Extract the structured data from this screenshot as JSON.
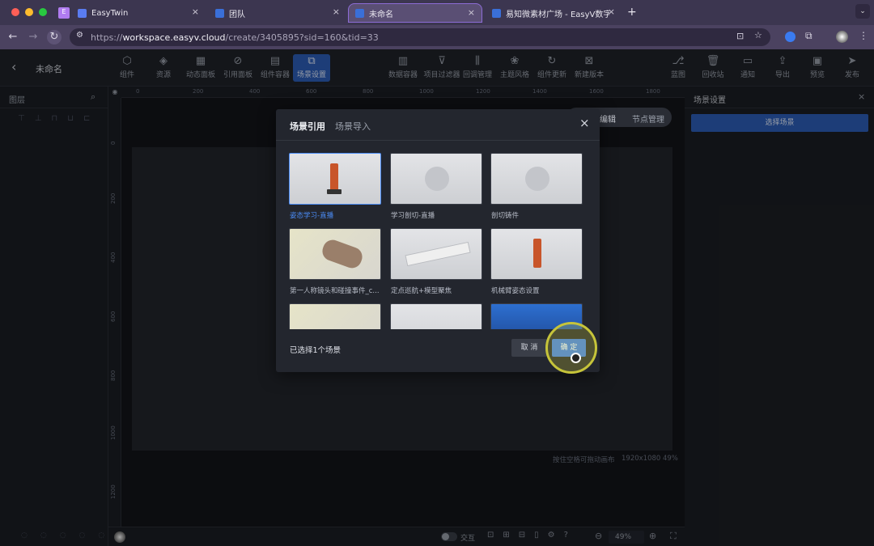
{
  "browser": {
    "tabs": [
      {
        "label": "",
        "icon": "E"
      },
      {
        "label": "EasyTwin"
      },
      {
        "label": "团队"
      },
      {
        "label": "未命名"
      },
      {
        "label": "易知微素材广场 - EasyV数字孪"
      }
    ],
    "url_prefix": "https://",
    "url_host": "workspace.easyv.cloud",
    "url_path": "/create/3405895?sid=160&tid=33"
  },
  "header": {
    "back_label": "‹",
    "title": "未命名",
    "left_tools": [
      {
        "label": "组件",
        "icon": "component-icon"
      },
      {
        "label": "资源",
        "icon": "layers-icon"
      },
      {
        "label": "动态面板",
        "icon": "panel-icon"
      },
      {
        "label": "引用面板",
        "icon": "link-icon"
      },
      {
        "label": "组件容器",
        "icon": "container-icon"
      },
      {
        "label": "场景设置",
        "icon": "scene-icon"
      }
    ],
    "mid_tools": [
      {
        "label": "数据容器",
        "icon": "data-icon"
      },
      {
        "label": "项目过滤器",
        "icon": "filter-icon"
      },
      {
        "label": "回调管理",
        "icon": "sliders-icon"
      },
      {
        "label": "主题风格",
        "icon": "theme-icon"
      },
      {
        "label": "组件更新",
        "icon": "refresh-icon"
      },
      {
        "label": "新建版本",
        "icon": "version-icon"
      }
    ],
    "right_tools": [
      {
        "label": "蓝图",
        "icon": "blueprint-icon"
      },
      {
        "label": "回收站",
        "icon": "trash-icon"
      },
      {
        "label": "通知",
        "icon": "message-icon"
      },
      {
        "label": "导出",
        "icon": "export-icon"
      },
      {
        "label": "预览",
        "icon": "preview-icon"
      },
      {
        "label": "发布",
        "icon": "send-icon"
      }
    ]
  },
  "left_panel": {
    "title": "图层"
  },
  "canvas": {
    "ruler_top": [
      "0",
      "200",
      "400",
      "600",
      "800",
      "1000",
      "1200",
      "1400",
      "1600",
      "1800"
    ],
    "ruler_left": [
      "0",
      "200",
      "400",
      "600",
      "800",
      "1000",
      "1200"
    ],
    "hint": "按住空格可拖动画布",
    "size": "1920x1080 49%",
    "mode_tabs": [
      "编辑",
      "节点管理"
    ],
    "interact_label": "交互",
    "zoom": "49%"
  },
  "right_panel": {
    "title": "场景设置",
    "select_button": "选择场景"
  },
  "modal": {
    "tab_active": "场景引用",
    "tab_inactive": "场景导入",
    "close": "×",
    "items": [
      {
        "label": "姿态学习-直播",
        "selected": true
      },
      {
        "label": "学习剖切-直播",
        "selected": false
      },
      {
        "label": "剖切铸件",
        "selected": false
      },
      {
        "label": "第一人称镜头和碰撞事件_c...",
        "selected": false
      },
      {
        "label": "定点巡航+模型聚焦",
        "selected": false
      },
      {
        "label": "机械臂姿态设置",
        "selected": false
      },
      {
        "label": "",
        "selected": false
      },
      {
        "label": "",
        "selected": false
      },
      {
        "label": "",
        "selected": false
      }
    ],
    "status": "已选择1个场景",
    "cancel": "取 消",
    "confirm": "确 定"
  },
  "colors": {
    "accent": "#2d5fb8",
    "selected": "#4b8cf5"
  }
}
